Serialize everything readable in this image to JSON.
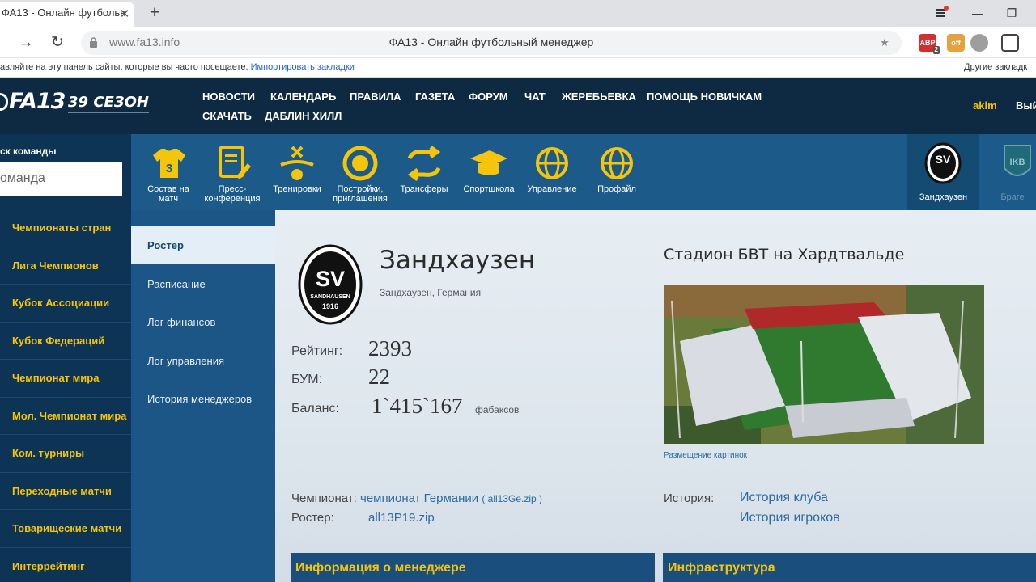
{
  "browser": {
    "tab_title": "ФА13 - Онлайн футбольн",
    "tab_close": "✕",
    "new_tab": "+",
    "window_min": "—",
    "window_restore": "❐",
    "back": "→",
    "reload": "↻",
    "domain": "www.fa13.info",
    "page_title": "ФА13 - Онлайн футбольный менеджер",
    "bookmark_star": "★",
    "extensions": [
      {
        "name": "abp",
        "label": "ABP",
        "badge": "2",
        "color": "#d32f2f"
      },
      {
        "name": "off",
        "label": "off",
        "color": "#e6a23c"
      },
      {
        "name": "ext-gray",
        "label": "",
        "color": "#9e9e9e"
      },
      {
        "name": "translate",
        "label": "",
        "color": "#444444"
      }
    ],
    "bookmarks_bar_text": "авляйте на эту панель сайты, которые вы часто посещаете.",
    "bookmarks_import": "Импортировать закладки",
    "other_bookmarks": "Другие закладк"
  },
  "header": {
    "logo": "FA13",
    "season": "39 СЕЗОН",
    "menu": [
      "НОВОСТИ",
      "КАЛЕНДАРЬ",
      "ПРАВИЛА",
      "ГАЗЕТА",
      "ФОРУМ",
      "ЧАТ",
      "ЖЕРЕБЬЕВКА",
      "ПОМОЩЬ НОВИЧКАМ",
      "СКАЧАТЬ",
      "ДАБЛИН ХИЛЛ"
    ],
    "user": "akim",
    "logout": "Вый"
  },
  "sidebar": {
    "search_label": "ск команды",
    "search_placeholder": "оманда",
    "items": [
      "Чемпионаты стран",
      "Лига Чемпионов",
      "Кубок Ассоциации",
      "Кубок Федераций",
      "Чемпионат мира",
      "Мол. Чемпионат мира",
      "Ком. турниры",
      "Переходные матчи",
      "Товарищеские матчи",
      "Интеррейтинг"
    ]
  },
  "toolbar": {
    "items": [
      {
        "label": "Состав на матч",
        "icon": "shirt-number-icon"
      },
      {
        "label": "Пресс-конференция",
        "icon": "press-document-icon"
      },
      {
        "label": "Тренировки",
        "icon": "training-icon"
      },
      {
        "label": "Постройки, приглашения",
        "icon": "buildings-icon"
      },
      {
        "label": "Трансферы",
        "icon": "transfer-arrows-icon"
      },
      {
        "label": "Спортшкола",
        "icon": "graduation-cap-icon"
      },
      {
        "label": "Управление",
        "icon": "management-globe-icon"
      },
      {
        "label": "Профайл",
        "icon": "profile-globe-icon"
      }
    ],
    "team_active": "Зандхаузен",
    "team_active_badge": "SV",
    "team_inactive": "Браге",
    "team_inactive_badge": "IKB"
  },
  "subnav": {
    "items": [
      "Ростер",
      "Расписание",
      "Лог финансов",
      "Лог управления",
      "История менеджеров"
    ],
    "active_index": 0
  },
  "team": {
    "logo_text": "SV",
    "logo_ring": "SANDHAUSEN",
    "logo_year": "1916",
    "name": "Зандхаузен",
    "location": "Зандхаузен, Германия",
    "rating_label": "Рейтинг:",
    "rating": "2393",
    "bum_label": "БУМ:",
    "bum": "22",
    "balance_label": "Баланс:",
    "balance": "1`415`167",
    "balance_unit": "фабаксов",
    "stadium_name": "Стадион БВТ на Хардтвальде",
    "image_note": "Размещение картинок",
    "championship_label": "Чемпионат:",
    "championship_link": "чемпионат Германии",
    "championship_file": "( all13Ge.zip )",
    "roster_label": "Ростер:",
    "roster_file": "all13P19.zip",
    "history_label": "История:",
    "history_club": "История клуба",
    "history_players": "История игроков",
    "section_manager": "Информация о менеджере",
    "section_infra": "Инфраструктура"
  },
  "colors": {
    "header_bg": "#0e2a42",
    "accent_yellow": "#f5c40c",
    "nav_bg": "#0d3454",
    "toolbar_bg": "#1c5a89"
  }
}
